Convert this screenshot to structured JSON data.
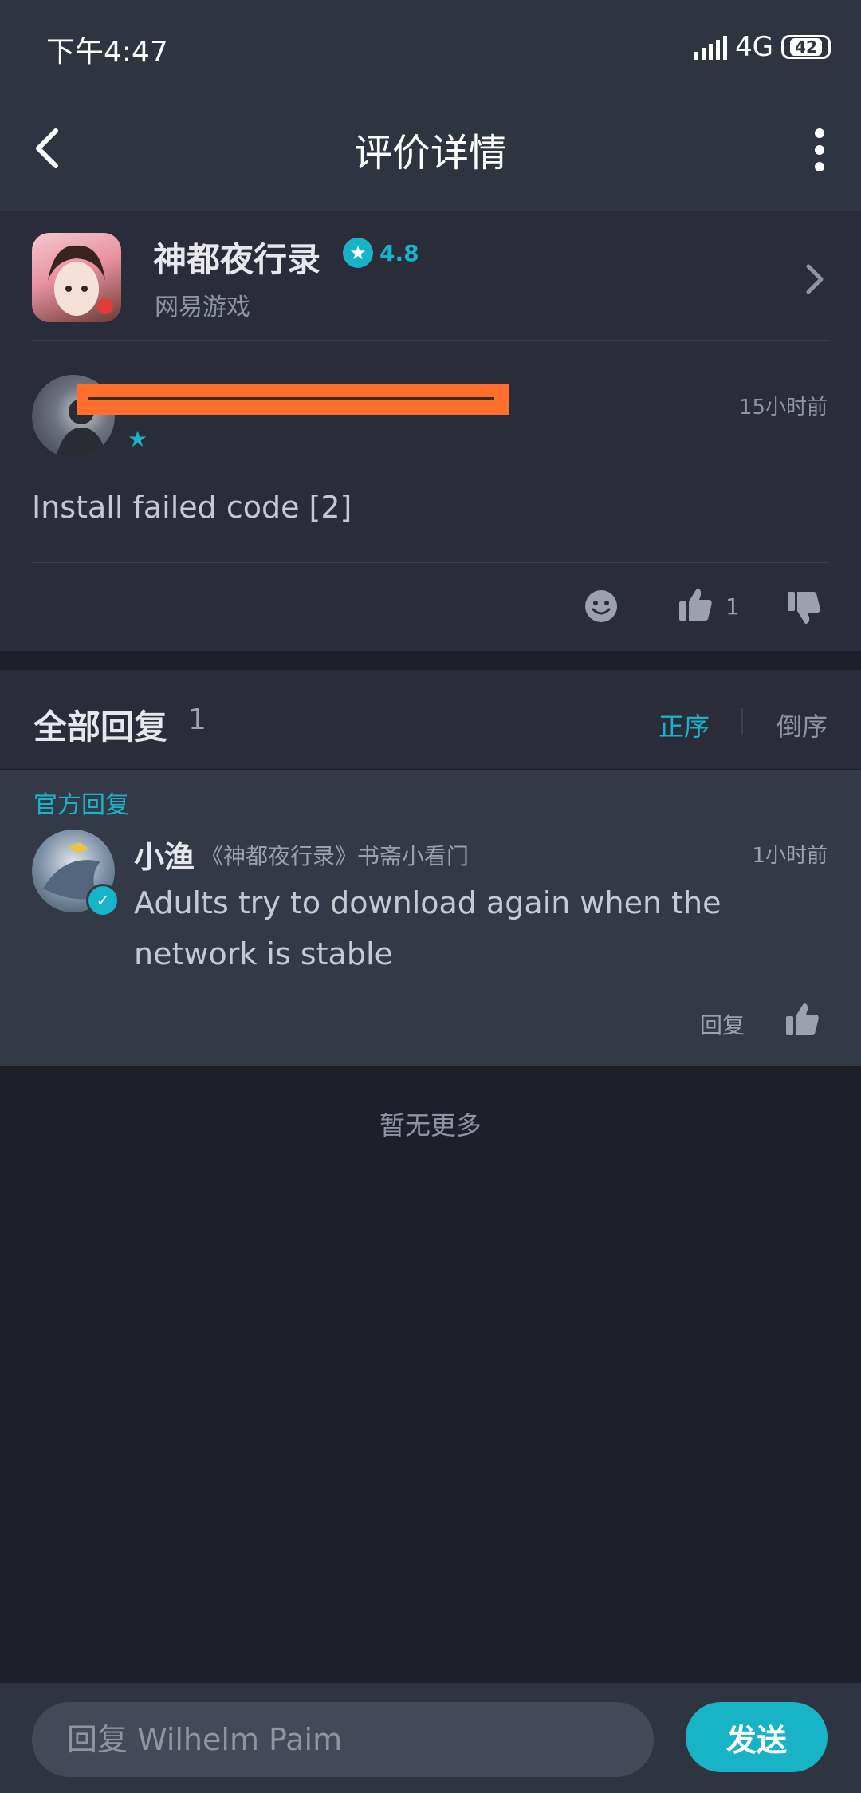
{
  "status_bar": {
    "time": "下午4:47",
    "network": "4G",
    "battery": "42"
  },
  "header": {
    "title": "评价详情",
    "back_icon": "chevron-left-icon",
    "more_icon": "more-vertical-icon"
  },
  "app_card": {
    "name": "神都夜行录",
    "rating": "4.8",
    "developer": "网易游戏"
  },
  "review": {
    "time": "15小时前",
    "text": "Install failed code [2]",
    "like_count": "1"
  },
  "replies": {
    "title": "全部回复",
    "count": "1",
    "sort_asc": "正序",
    "sort_desc": "倒序",
    "items": [
      {
        "official_label": "官方回复",
        "name": "小渔",
        "title": "《神都夜行录》书斋小看门",
        "time": "1小时前",
        "text": "Adults try to download again when the network is stable",
        "reply_action": "回复"
      }
    ],
    "no_more": "暂无更多"
  },
  "composer": {
    "placeholder": "回复 Wilhelm Paim",
    "send_label": "发送"
  },
  "colors": {
    "accent": "#18b3c6",
    "redaction": "#ff6f2b"
  }
}
